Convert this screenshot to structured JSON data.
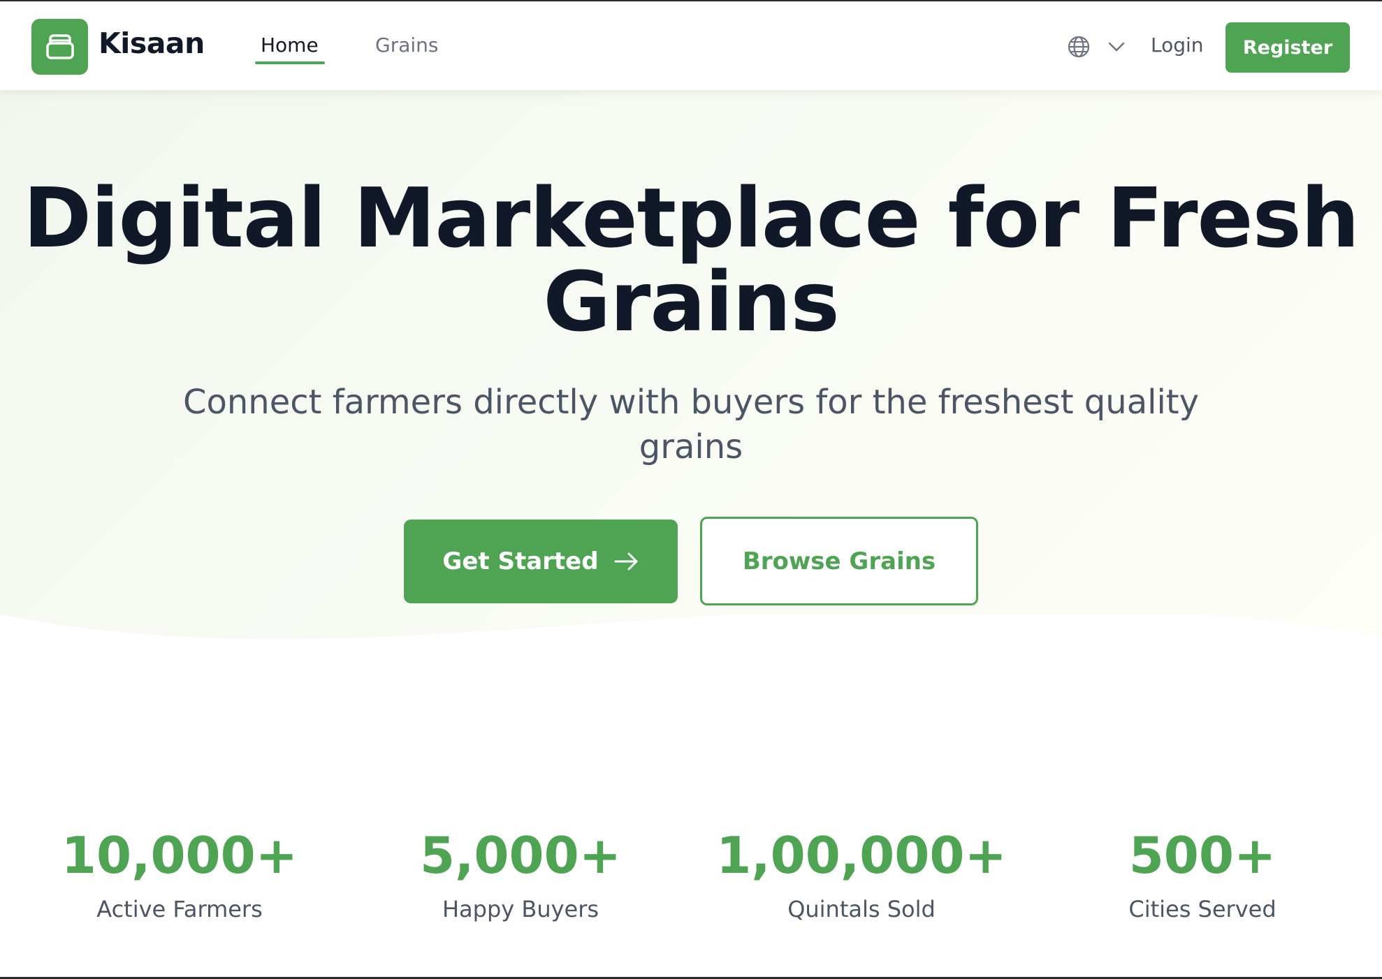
{
  "nav": {
    "brand": "Kisaan",
    "links": [
      "Home",
      "Grains"
    ],
    "active_link": "Home",
    "language_icon": "globe-icon",
    "login_label": "Login",
    "register_label": "Register"
  },
  "hero": {
    "title_line1": "Digital Marketplace for Fresh",
    "title_line2": "Grains",
    "subtitle_line1": "Connect farmers directly with buyers for the freshest quality",
    "subtitle_line2": "grains",
    "primary_button": "Get Started",
    "secondary_button": "Browse Grains"
  },
  "stats": [
    {
      "value": "10,000+",
      "label": "Active Farmers"
    },
    {
      "value": "5,000+",
      "label": "Happy Buyers"
    },
    {
      "value": "1,00,000+",
      "label": "Quintals Sold"
    },
    {
      "value": "500+",
      "label": "Cities Served"
    }
  ],
  "colors": {
    "accent": "#4fa453",
    "heading": "#111827",
    "muted": "#4b5563"
  }
}
